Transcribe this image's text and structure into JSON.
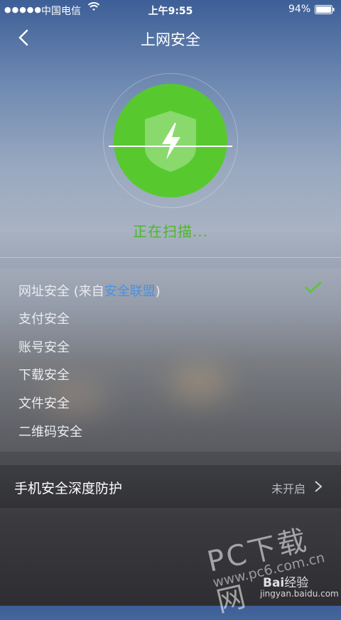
{
  "status_bar": {
    "carrier": "中国电信",
    "time": "上午9:55",
    "battery": "94%"
  },
  "nav": {
    "title": "上网安全"
  },
  "scan": {
    "status_text": "正在扫描..."
  },
  "list": {
    "items": [
      {
        "prefix": "网址安全 (来自",
        "link": "安全联盟",
        "suffix": ")"
      },
      {
        "label": "支付安全"
      },
      {
        "label": "账号安全"
      },
      {
        "label": "下载安全"
      },
      {
        "label": "文件安全"
      },
      {
        "label": "二维码安全"
      }
    ]
  },
  "deep_protection": {
    "label": "手机安全深度防护",
    "status": "未开启"
  },
  "watermark": {
    "pc": "PC下载网",
    "site": "www.pc6.com.cn",
    "baidu": "经验",
    "baidu_url": "jingyan.baidu.com"
  },
  "colors": {
    "accent_green": "#57c92e",
    "link_blue": "#4a90e2",
    "scan_text_green": "#4fb72a"
  }
}
